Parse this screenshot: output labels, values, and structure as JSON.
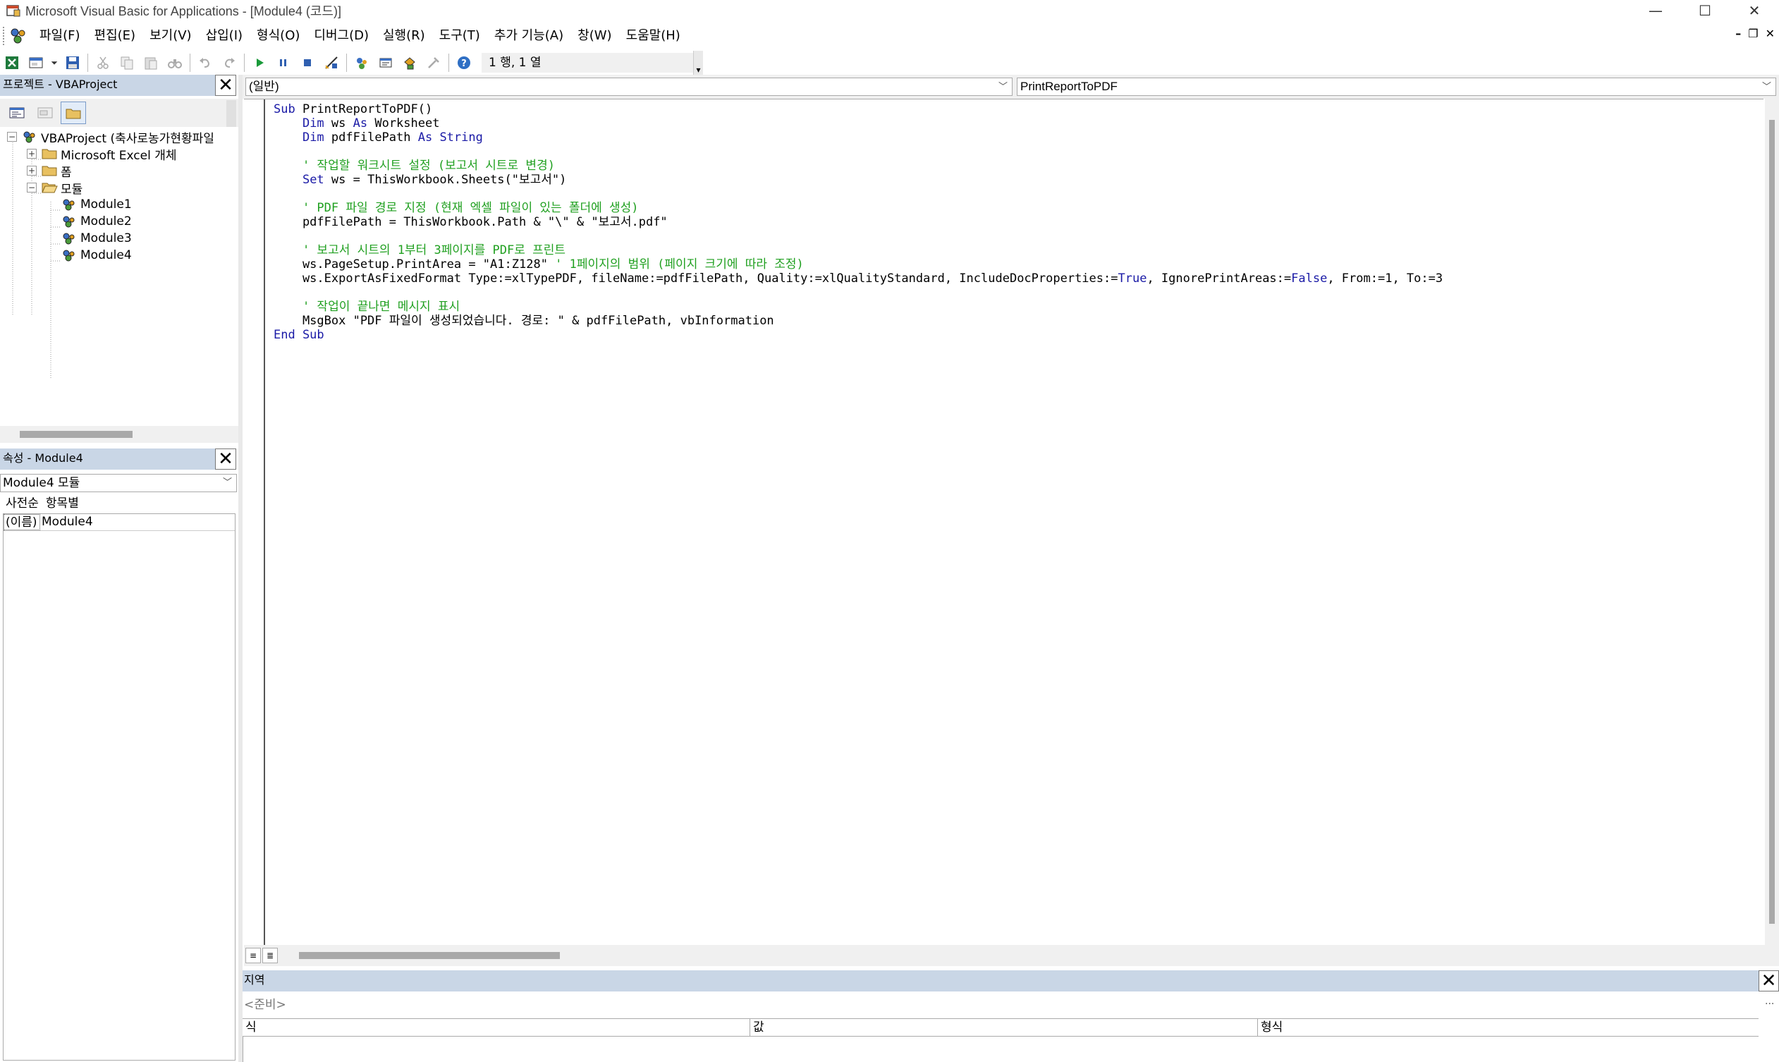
{
  "window": {
    "title": "Microsoft Visual Basic for Applications - [Module4 (코드)]",
    "minimize": "—",
    "maximize": "☐",
    "close": "✕"
  },
  "menubar": {
    "items": [
      "파일(F)",
      "편집(E)",
      "보기(V)",
      "삽입(I)",
      "형식(O)",
      "디버그(D)",
      "실행(R)",
      "도구(T)",
      "추가 기능(A)",
      "창(W)",
      "도움말(H)"
    ],
    "mdi_minimize": "–",
    "mdi_restore": "❐",
    "mdi_close": "✕"
  },
  "toolbar": {
    "position": "1 행, 1 열"
  },
  "project_panel": {
    "title": "프로젝트 - VBAProject",
    "close": "✕",
    "tree": {
      "root": "VBAProject (축사로농가현황파일",
      "excel_objects": "Microsoft Excel 개체",
      "forms": "폼",
      "modules": "모듈",
      "module_items": [
        "Module1",
        "Module2",
        "Module3",
        "Module4"
      ]
    }
  },
  "properties_panel": {
    "title": "속성 - Module4",
    "close": "✕",
    "object_select": "Module4 모듈",
    "tabs": [
      "사전순",
      "항목별"
    ],
    "rows": [
      {
        "key": "(이름)",
        "value": "Module4"
      }
    ]
  },
  "code_window": {
    "object_combo": "(일반)",
    "procedure_combo": "PrintReportToPDF",
    "view_buttons": [
      "≡",
      "≣"
    ]
  },
  "locals": {
    "title": "지역",
    "close": "✕",
    "context": "<준비>",
    "dots": "...",
    "columns": [
      "식",
      "값",
      "형식"
    ]
  },
  "colors": {
    "keyword": "#1a1aa6",
    "comment": "#20a020",
    "panel_title_bg": "#c9d6e6"
  }
}
